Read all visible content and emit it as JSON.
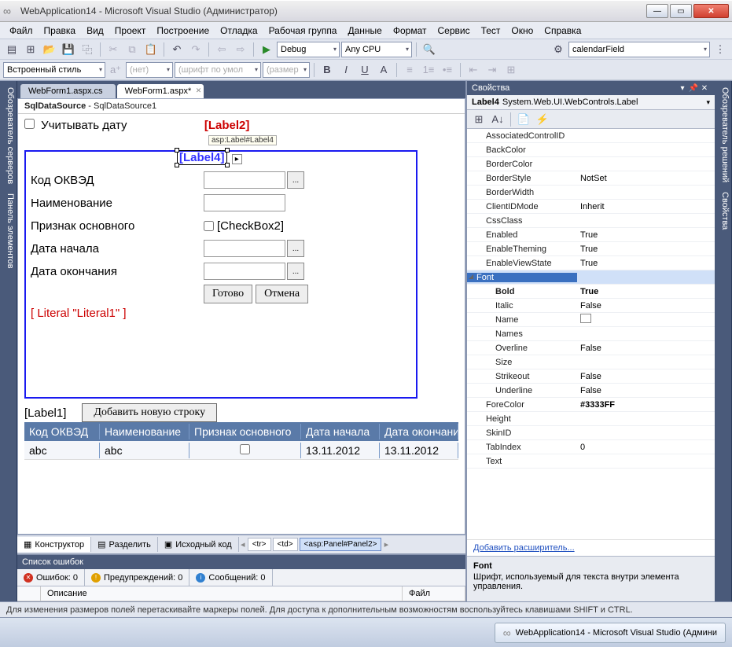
{
  "window": {
    "title": "WebApplication14 - Microsoft Visual Studio (Администратор)"
  },
  "menu": [
    "Файл",
    "Правка",
    "Вид",
    "Проект",
    "Построение",
    "Отладка",
    "Рабочая группа",
    "Данные",
    "Формат",
    "Сервис",
    "Тест",
    "Окно",
    "Справка"
  ],
  "toolbar1": {
    "config": "Debug",
    "platform": "Any CPU",
    "find": "calendarField"
  },
  "toolbar2": {
    "style": "Встроенный стиль",
    "none": "(нет)",
    "font": "(шрифт по умол",
    "size": "(размер"
  },
  "leftTabs": [
    "Обозреватель серверов",
    "Панель элементов"
  ],
  "rightTabs": [
    "Обозреватель решений",
    "Свойства"
  ],
  "docTabs": [
    {
      "label": "WebForm1.aspx.cs",
      "active": false
    },
    {
      "label": "WebForm1.aspx*",
      "active": true
    }
  ],
  "designer": {
    "dsHeader": "SqlDataSource - SqlDataSource1",
    "considerDate": "Учитывать дату",
    "label2": "[Label2]",
    "tagHint": "asp:Label#Label4",
    "label4": "[Label4]",
    "field_okved": "Код ОКВЭД",
    "field_name": "Наименование",
    "field_main": "Признак основного",
    "checkbox2": "[CheckBox2]",
    "field_start": "Дата начала",
    "field_end": "Дата окончания",
    "btn_ready": "Готово",
    "btn_cancel": "Отмена",
    "literal": "[ Literal \"Literal1\" ]",
    "label1": "[Label1]",
    "btn_add": "Добавить новую строку",
    "grid_headers": [
      "Код ОКВЭД",
      "Наименование",
      "Признак основного",
      "Дата начала",
      "Дата окончания"
    ],
    "grid_row": [
      "abc",
      "abc",
      "",
      "13.11.2012",
      "13.11.2012"
    ]
  },
  "viewSwitch": {
    "design": "Конструктор",
    "split": "Разделить",
    "source": "Исходный код",
    "crumbs": [
      "<tr>",
      "<td>",
      "<asp:Panel#Panel2>"
    ]
  },
  "errorList": {
    "title": "Список ошибок",
    "errors": "Ошибок: 0",
    "warnings": "Предупреждений: 0",
    "messages": "Сообщений: 0",
    "col_desc": "Описание",
    "col_file": "Файл"
  },
  "properties": {
    "title": "Свойства",
    "selected_name": "Label4",
    "selected_type": "System.Web.UI.WebControls.Label",
    "rows": [
      {
        "n": "AssociatedControlID",
        "v": ""
      },
      {
        "n": "BackColor",
        "v": ""
      },
      {
        "n": "BorderColor",
        "v": ""
      },
      {
        "n": "BorderStyle",
        "v": "NotSet"
      },
      {
        "n": "BorderWidth",
        "v": ""
      },
      {
        "n": "ClientIDMode",
        "v": "Inherit"
      },
      {
        "n": "CssClass",
        "v": ""
      },
      {
        "n": "Enabled",
        "v": "True"
      },
      {
        "n": "EnableTheming",
        "v": "True"
      },
      {
        "n": "EnableViewState",
        "v": "True"
      }
    ],
    "fontCat": "Font",
    "fontRows": [
      {
        "n": "Bold",
        "v": "True",
        "bold": true,
        "both": true
      },
      {
        "n": "Italic",
        "v": "False"
      },
      {
        "n": "Name",
        "v": "",
        "swatch": true
      },
      {
        "n": "Names",
        "v": ""
      },
      {
        "n": "Overline",
        "v": "False"
      },
      {
        "n": "Size",
        "v": ""
      },
      {
        "n": "Strikeout",
        "v": "False"
      },
      {
        "n": "Underline",
        "v": "False"
      }
    ],
    "moreRows": [
      {
        "n": "ForeColor",
        "v": "#3333FF",
        "bold": true
      },
      {
        "n": "Height",
        "v": ""
      },
      {
        "n": "SkinID",
        "v": ""
      },
      {
        "n": "TabIndex",
        "v": "0"
      },
      {
        "n": "Text",
        "v": ""
      }
    ],
    "extender": "Добавить расширитель...",
    "desc_title": "Font",
    "desc_body": "Шрифт, используемый для текста внутри элемента управления."
  },
  "status": "Для изменения размеров полей перетаскивайте маркеры полей. Для доступа к дополнительным возможностям воспользуйтесь клавишами SHIFT и CTRL.",
  "taskbar": {
    "item": "WebApplication14 - Microsoft Visual Studio (Админи"
  }
}
